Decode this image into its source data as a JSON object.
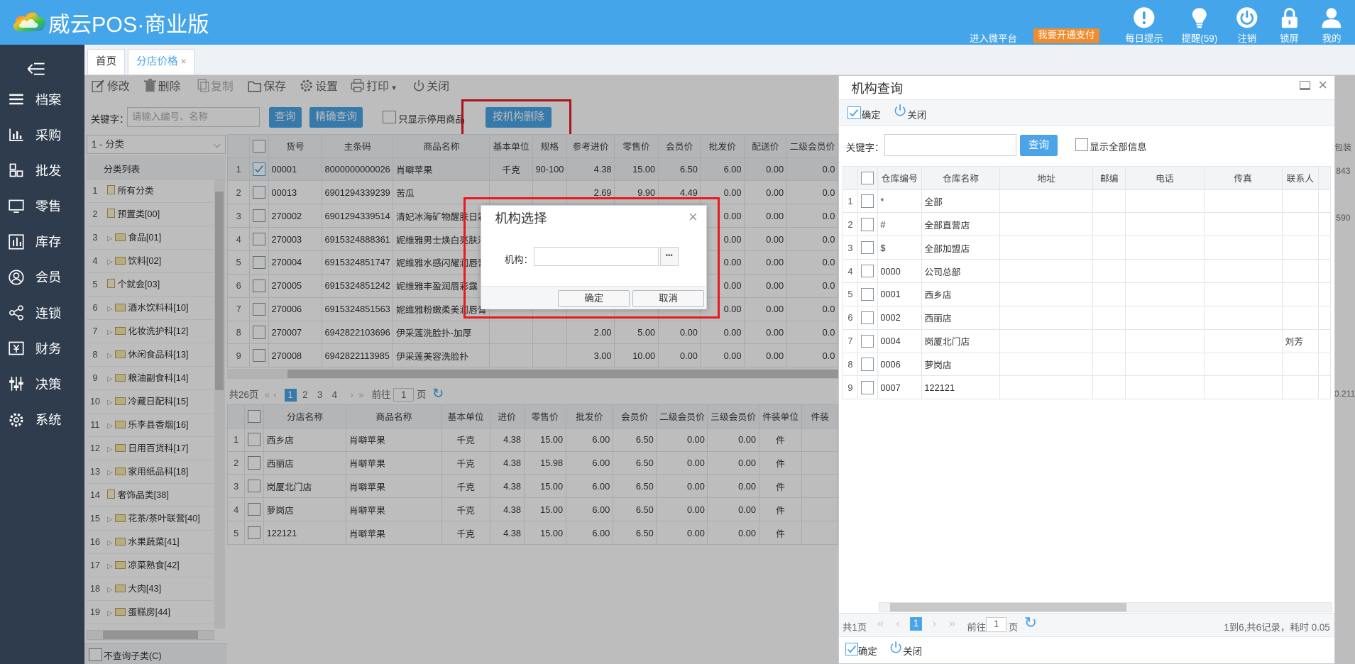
{
  "app": {
    "title": "威云POS·商业版"
  },
  "header": {
    "link_weixin": "进入微平台",
    "badge_pay": "我要开通支付",
    "buttons": [
      {
        "label": "每日提示",
        "icon": "alert-icon"
      },
      {
        "label": "提醒(59)",
        "icon": "bulb-icon"
      },
      {
        "label": "注销",
        "icon": "power-icon"
      },
      {
        "label": "锁屏",
        "icon": "lock-icon"
      },
      {
        "label": "我的",
        "icon": "user-icon"
      }
    ]
  },
  "sidebar": {
    "items": [
      {
        "label": "档案",
        "icon": "list-icon"
      },
      {
        "label": "采购",
        "icon": "bar-chart-icon"
      },
      {
        "label": "批发",
        "icon": "blocks-icon"
      },
      {
        "label": "零售",
        "icon": "monitor-icon"
      },
      {
        "label": "库存",
        "icon": "inventory-icon"
      },
      {
        "label": "会员",
        "icon": "member-icon"
      },
      {
        "label": "连锁",
        "icon": "share-icon"
      },
      {
        "label": "财务",
        "icon": "finance-icon"
      },
      {
        "label": "决策",
        "icon": "sliders-icon"
      },
      {
        "label": "系统",
        "icon": "gear-icon"
      }
    ]
  },
  "tabs": [
    {
      "label": "首页"
    },
    {
      "label": "分店价格"
    }
  ],
  "toolbar": {
    "edit": "修改",
    "delete": "删除",
    "copy": "复制",
    "save": "保存",
    "settings": "设置",
    "print": "打印",
    "close": "关闭"
  },
  "search": {
    "keyword_label": "关键字：",
    "placeholder": "请输入编号、名称",
    "query": "查询",
    "exact_query": "精确查询",
    "show_disabled": "只显示停用商品",
    "delete_by_org": "按机构删除"
  },
  "category": {
    "select_value": "1 - 分类",
    "list_header": "分类列表",
    "items": [
      {
        "num": "1",
        "label": "所有分类",
        "kind": "doc"
      },
      {
        "num": "2",
        "label": "预置类[00]",
        "kind": "doc"
      },
      {
        "num": "3",
        "label": "食品[01]",
        "kind": "folder"
      },
      {
        "num": "4",
        "label": "饮料[02]",
        "kind": "folder"
      },
      {
        "num": "5",
        "label": "个就会[03]",
        "kind": "doc"
      },
      {
        "num": "6",
        "label": "酒水饮料科[10]",
        "kind": "folder"
      },
      {
        "num": "7",
        "label": "化妆洗护科[12]",
        "kind": "folder"
      },
      {
        "num": "8",
        "label": "休闲食品科[13]",
        "kind": "folder"
      },
      {
        "num": "9",
        "label": "粮油副食科[14]",
        "kind": "folder"
      },
      {
        "num": "10",
        "label": "冷藏日配科[15]",
        "kind": "folder"
      },
      {
        "num": "11",
        "label": "乐李县香烟[16]",
        "kind": "folder"
      },
      {
        "num": "12",
        "label": "日用百货科[17]",
        "kind": "folder"
      },
      {
        "num": "13",
        "label": "家用纸品科[18]",
        "kind": "folder"
      },
      {
        "num": "14",
        "label": "奢饰品类[38]",
        "kind": "doc"
      },
      {
        "num": "15",
        "label": "花茶/茶叶联营[40]",
        "kind": "folder"
      },
      {
        "num": "16",
        "label": "水果蔬菜[41]",
        "kind": "folder"
      },
      {
        "num": "17",
        "label": "凉菜熟食[42]",
        "kind": "folder"
      },
      {
        "num": "18",
        "label": "大肉[43]",
        "kind": "folder"
      },
      {
        "num": "19",
        "label": "蛋糕房[44]",
        "kind": "folder"
      },
      {
        "num": "20",
        "label": "",
        "kind": "none"
      }
    ],
    "no_subcat": "不查询子类(C)"
  },
  "products": {
    "columns": [
      "",
      "",
      "货号",
      "主条码",
      "商品名称",
      "基本单位",
      "规格",
      "参考进价",
      "零售价",
      "会员价",
      "批发价",
      "配送价",
      "二级会员价"
    ],
    "rows": [
      {
        "n": "1",
        "code": "00001",
        "barcode": "8000000000026",
        "name": "肖噼苹果",
        "unit": "千克",
        "spec": "90-100",
        "cost": "4.38",
        "retail": "15.00",
        "member": "6.50",
        "wholesale": "6.00",
        "delivery": "0.00",
        "m2": "0.0",
        "checked": true
      },
      {
        "n": "2",
        "code": "00013",
        "barcode": "6901294339239",
        "name": "苦瓜",
        "unit": "",
        "spec": "",
        "cost": "2.69",
        "retail": "9.90",
        "member": "4.49",
        "wholesale": "0.00",
        "delivery": "0.00",
        "m2": "0.0",
        "checked": false
      },
      {
        "n": "3",
        "code": "270002",
        "barcode": "6901294339514",
        "name": "清妃冰海矿物醒肤日霜",
        "unit": "",
        "spec": "",
        "cost": "",
        "retail": "",
        "member": "",
        "wholesale": "0.00",
        "delivery": "0.00",
        "m2": "0.0",
        "checked": false
      },
      {
        "n": "4",
        "code": "270003",
        "barcode": "6915324888361",
        "name": "妮维雅男士焕白亮肤液",
        "unit": "",
        "spec": "",
        "cost": "",
        "retail": "",
        "member": "",
        "wholesale": "0.00",
        "delivery": "0.00",
        "m2": "0.0",
        "checked": false
      },
      {
        "n": "5",
        "code": "270004",
        "barcode": "6915324851747",
        "name": "妮维雅水感闪耀润唇膏",
        "unit": "",
        "spec": "",
        "cost": "",
        "retail": "",
        "member": "",
        "wholesale": "0.00",
        "delivery": "0.00",
        "m2": "0.0",
        "checked": false
      },
      {
        "n": "6",
        "code": "270005",
        "barcode": "6915324851242",
        "name": "妮维雅丰盈润唇彩露",
        "unit": "",
        "spec": "",
        "cost": "",
        "retail": "",
        "member": "",
        "wholesale": "0.00",
        "delivery": "0.00",
        "m2": "0.0",
        "checked": false
      },
      {
        "n": "7",
        "code": "270006",
        "barcode": "6915324851563",
        "name": "妮维雅粉嫩柔美润唇膏",
        "unit": "",
        "spec": "",
        "cost": "",
        "retail": "",
        "member": "",
        "wholesale": "0.00",
        "delivery": "0.00",
        "m2": "0.0",
        "checked": false
      },
      {
        "n": "8",
        "code": "270007",
        "barcode": "6942822103696",
        "name": "伊采莲洗脸扑-加厚",
        "unit": "",
        "spec": "",
        "cost": "2.00",
        "retail": "5.00",
        "member": "0.00",
        "wholesale": "0.00",
        "delivery": "0.00",
        "m2": "0.0",
        "checked": false
      },
      {
        "n": "9",
        "code": "270008",
        "barcode": "6942822113985",
        "name": "伊采莲美容洗脸扑",
        "unit": "",
        "spec": "",
        "cost": "3.00",
        "retail": "10.00",
        "member": "0.00",
        "wholesale": "0.00",
        "delivery": "0.00",
        "m2": "0.0",
        "checked": false
      }
    ],
    "pager": {
      "total": "共26页",
      "pages": [
        "1",
        "2",
        "3",
        "4"
      ],
      "goto": "前往",
      "page": "1",
      "unit": "页"
    }
  },
  "branch_prices": {
    "columns": [
      "",
      "",
      "分店名称",
      "商品名称",
      "基本单位",
      "进价",
      "零售价",
      "批发价",
      "会员价",
      "二级会员价",
      "三级会员价",
      "件装单位",
      "件装"
    ],
    "rows": [
      {
        "n": "1",
        "store": "西乡店",
        "name": "肖噼苹果",
        "unit": "千克",
        "cost": "4.38",
        "retail": "15.00",
        "wholesale": "6.00",
        "member": "6.50",
        "m2": "0.00",
        "m3": "0.00",
        "pack": "件"
      },
      {
        "n": "2",
        "store": "西丽店",
        "name": "肖噼苹果",
        "unit": "千克",
        "cost": "4.38",
        "retail": "15.98",
        "wholesale": "6.00",
        "member": "6.50",
        "m2": "0.00",
        "m3": "0.00",
        "pack": "件"
      },
      {
        "n": "3",
        "store": "岗厦北门店",
        "name": "肖噼苹果",
        "unit": "千克",
        "cost": "4.38",
        "retail": "15.00",
        "wholesale": "6.00",
        "member": "6.50",
        "m2": "0.00",
        "m3": "0.00",
        "pack": "件"
      },
      {
        "n": "4",
        "store": "萝岗店",
        "name": "肖噼苹果",
        "unit": "千克",
        "cost": "4.38",
        "retail": "15.00",
        "wholesale": "6.00",
        "member": "6.50",
        "m2": "0.00",
        "m3": "0.00",
        "pack": "件"
      },
      {
        "n": "5",
        "store": "122121",
        "name": "肖噼苹果",
        "unit": "千克",
        "cost": "4.38",
        "retail": "15.00",
        "wholesale": "6.00",
        "member": "6.50",
        "m2": "0.00",
        "m3": "0.00",
        "pack": "件"
      }
    ]
  },
  "org_dialog": {
    "title": "机构选择",
    "org_label": "机构：",
    "org_value": "",
    "ellipsis": "•••",
    "ok": "确定",
    "cancel": "取消"
  },
  "org_query": {
    "title": "机构查询",
    "ok": "确定",
    "close": "关闭",
    "keyword_label": "关键字：",
    "keyword_value": "",
    "query": "查询",
    "show_all": "显示全部信息",
    "columns": [
      "",
      "",
      "仓库编号",
      "仓库名称",
      "地址",
      "邮编",
      "电话",
      "传真",
      "联系人"
    ],
    "rows": [
      {
        "n": "1",
        "code": "*",
        "name": "全部",
        "contact": ""
      },
      {
        "n": "2",
        "code": "#",
        "name": "全部直营店",
        "contact": ""
      },
      {
        "n": "3",
        "code": "$",
        "name": "全部加盟店",
        "contact": ""
      },
      {
        "n": "4",
        "code": "0000",
        "name": "公司总部",
        "contact": ""
      },
      {
        "n": "5",
        "code": "0001",
        "name": "西乡店",
        "contact": ""
      },
      {
        "n": "6",
        "code": "0002",
        "name": "西丽店",
        "contact": ""
      },
      {
        "n": "7",
        "code": "0004",
        "name": "岗厦北门店",
        "contact": "刘芳"
      },
      {
        "n": "8",
        "code": "0006",
        "name": "萝岗店",
        "contact": ""
      },
      {
        "n": "9",
        "code": "0007",
        "name": "122121",
        "contact": ""
      }
    ],
    "pager": {
      "total": "共1页",
      "page_num": "1",
      "goto": "前往",
      "page": "1",
      "unit": "页",
      "summary": "1到6,共6记录，耗时 0.05"
    }
  },
  "right_clip": {
    "r1": "包装",
    "r2": "843",
    "r3": "590",
    "r4": "0.211"
  },
  "colors": {
    "header": "#45a5ea",
    "sidebar": "#2f3c4e",
    "accent": "#4aa4e7",
    "badge": "#f08c2e",
    "highlight": "#e8191f"
  }
}
